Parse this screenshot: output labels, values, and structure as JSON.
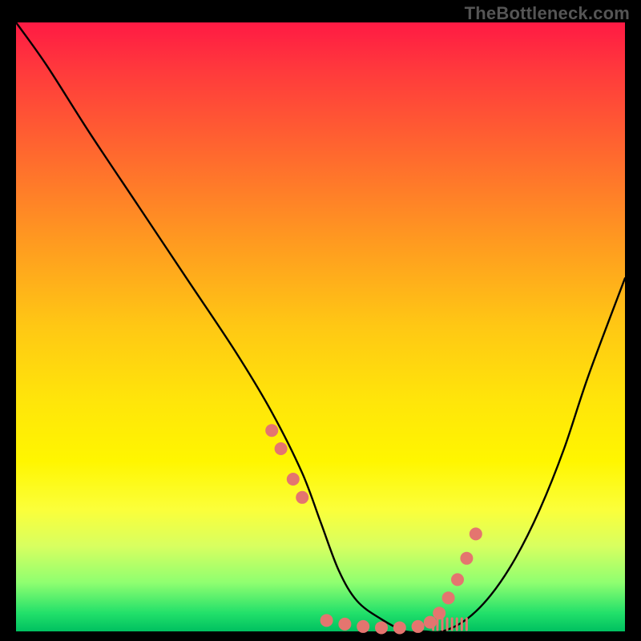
{
  "watermark": "TheBottleneck.com",
  "chart_data": {
    "type": "line",
    "title": "",
    "xlabel": "",
    "ylabel": "",
    "xlim": [
      0,
      100
    ],
    "ylim": [
      0,
      100
    ],
    "series": [
      {
        "name": "bottleneck-curve",
        "x": [
          0,
          5,
          12,
          20,
          28,
          36,
          42,
          47,
          50,
          53,
          56,
          60,
          64,
          67,
          70,
          74,
          78,
          82,
          86,
          90,
          94,
          100
        ],
        "y": [
          100,
          93,
          82,
          70,
          58,
          46,
          36,
          26,
          18,
          10,
          5,
          2,
          0,
          0,
          0,
          2,
          6,
          12,
          20,
          30,
          42,
          58
        ]
      }
    ],
    "markers": {
      "name": "highlight-dots",
      "color": "#e4756f",
      "x": [
        42,
        43.5,
        45.5,
        47,
        51,
        54,
        57,
        60,
        63,
        66,
        68,
        69.5,
        71,
        72.5,
        74,
        75.5
      ],
      "y": [
        33,
        30,
        25,
        22,
        1.8,
        1.2,
        0.8,
        0.6,
        0.6,
        0.8,
        1.5,
        3,
        5.5,
        8.5,
        12,
        16
      ]
    },
    "ticks": {
      "name": "floor-ticks",
      "color": "#e4756f",
      "x": [
        68.5,
        69.2,
        70.0,
        70.8,
        71.6,
        72.4,
        73.2,
        74.0
      ]
    }
  }
}
